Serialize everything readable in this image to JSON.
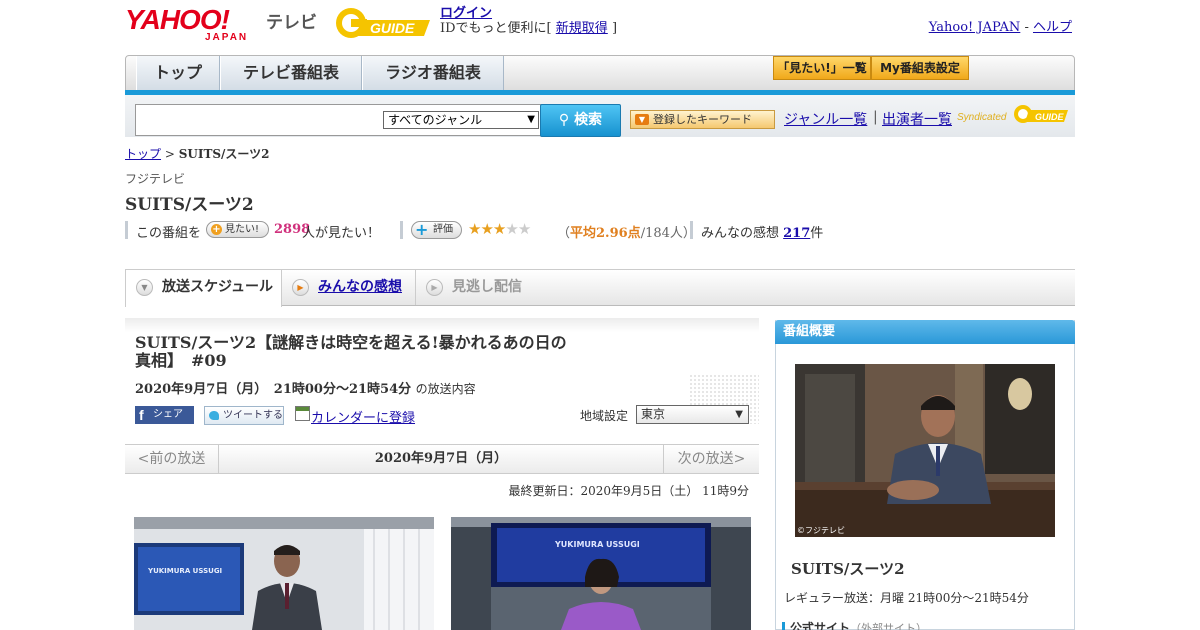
{
  "header": {
    "logo_text": "YAHOO!",
    "logo_sub": "JAPAN",
    "tv_label": "テレビ",
    "gguide_text": "GUIDE",
    "login_label": "ログイン",
    "login_prompt": "IDでもっと便利に[",
    "signup_label": "新規取得",
    "login_prompt_end": "]",
    "yahoo_japan_link": "Yahoo! JAPAN",
    "link_separator": " - ",
    "help_link": "ヘルプ"
  },
  "nav": {
    "tabs": [
      {
        "label": "トップ"
      },
      {
        "label": "テレビ番組表"
      },
      {
        "label": "ラジオ番組表"
      }
    ],
    "mitai_list_label": "「見たい!」一覧",
    "my_settings_label": "My番組表設定"
  },
  "search": {
    "input_value": "",
    "genre_selected": "すべてのジャンル",
    "search_button_label": "検索",
    "keyword_button_label": "登録したキーワード",
    "genre_list_link": "ジャンル一覧",
    "separator": "|",
    "performer_list_link": "出演者一覧",
    "syndicated_label": "Syndicated",
    "syndicated_logo_text": "GUIDE"
  },
  "breadcrumb": {
    "home": "トップ",
    "separator": " > ",
    "current": "SUITS/スーツ2"
  },
  "program": {
    "channel": "フジテレビ",
    "title": "SUITS/スーツ2"
  },
  "stats": {
    "mitai_prefix": "この番組を",
    "mitai_button": "見たい!",
    "mitai_count": "2898",
    "mitai_suffix": "人が見たい！",
    "rate_button": "評価",
    "rating_value": 2.96,
    "avg_open": "（",
    "avg_label": "平均2.96点",
    "avg_people": "/184人）",
    "impressions_label": "みんなの感想 ",
    "impressions_count": "217",
    "impressions_unit": "件",
    "colors": {
      "mitai_count": "#d0307c",
      "avg": "#e08020",
      "star": "#e8a020"
    }
  },
  "tabs": [
    {
      "label": "放送スケジュール",
      "state": "active"
    },
    {
      "label": "みんなの感想",
      "state": "link"
    },
    {
      "label": "見逃し配信",
      "state": "disabled"
    }
  ],
  "episode": {
    "title": "SUITS/スーツ2【謎解きは時空を超える!暴かれるあの日の真相】　#09",
    "date": "2020年9月7日（月）　21時00分～21時54分",
    "date_suffix": "の放送内容",
    "share_facebook": "シェア",
    "share_facebook_logo": "f",
    "share_twitter": "ツイートする",
    "calendar_link": "カレンダーに登録",
    "region_label": "地域設定",
    "region_selected": "東京"
  },
  "pager": {
    "prev": "<前の放送",
    "date": "2020年9月7日（月）",
    "next": "次の放送>"
  },
  "updated": "最終更新日：2020年9月5日（土）  11時9分",
  "photos": [
    {
      "sign_text": "YUKIMURA USSUGI"
    },
    {
      "sign_text": "YUKIMURA USSUGI"
    }
  ],
  "sidebar": {
    "heading": "番組概要",
    "photo_credit": "©フジテレビ",
    "title": "SUITS/スーツ2",
    "regular": "レギュラー放送：月曜 21時00分～21時54分",
    "official_label": "公式サイト",
    "official_sub": "（外部サイト）"
  }
}
